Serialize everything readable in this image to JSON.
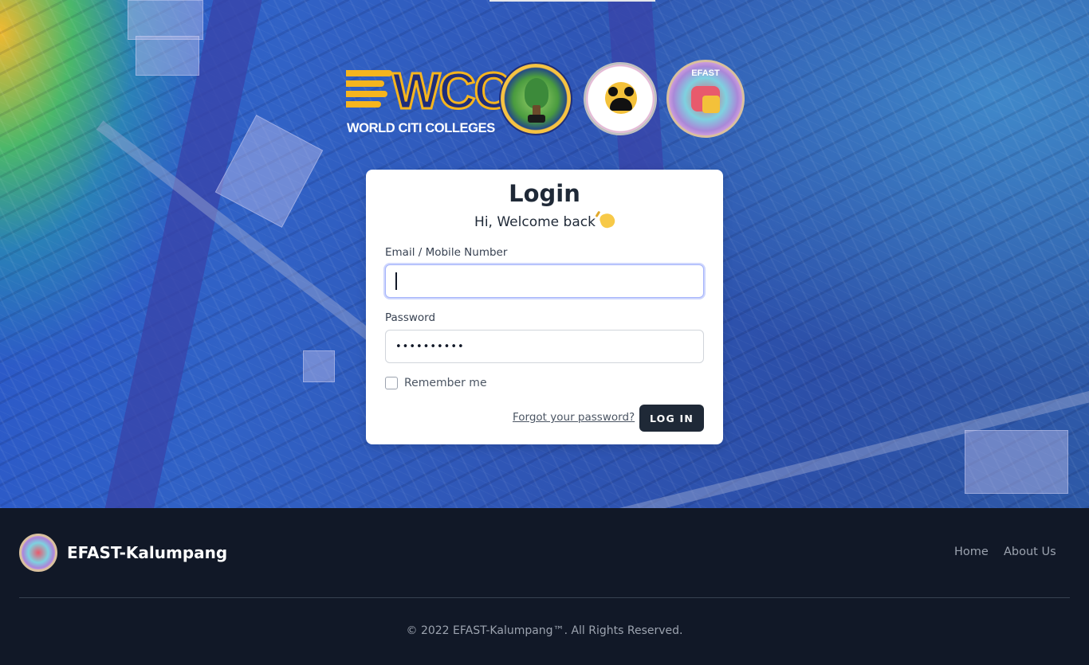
{
  "header": {
    "logos": [
      {
        "name": "wcc-logo",
        "letters": "WCC",
        "text": "WORLD CITI COLLEGES"
      },
      {
        "name": "barangay-seal"
      },
      {
        "name": "community-services-seal"
      },
      {
        "name": "efast-kalumpang-seal"
      }
    ]
  },
  "login": {
    "title": "Login",
    "subtitle": "Hi, Welcome back",
    "email_label": "Email / Mobile Number",
    "email_value": "",
    "password_label": "Password",
    "password_value": "••••••••••",
    "remember_label": "Remember me",
    "remember_checked": false,
    "forgot_label": "Forgot your password?",
    "submit_label": "LOG IN"
  },
  "footer": {
    "brand": "EFAST-Kalumpang",
    "nav": [
      {
        "label": "Home"
      },
      {
        "label": "About Us"
      }
    ],
    "copyright": "© 2022 EFAST-Kalumpang™. All Rights Reserved."
  },
  "colors": {
    "accent_dark": "#1f2937",
    "footer_bg": "#111827",
    "focus_ring": "#a5b4fc",
    "wcc_gold": "#f6b51e",
    "wcc_blue": "#1f2d7a"
  },
  "icons": {
    "wave": "waving-hand-icon",
    "checkbox": "checkbox-icon"
  }
}
